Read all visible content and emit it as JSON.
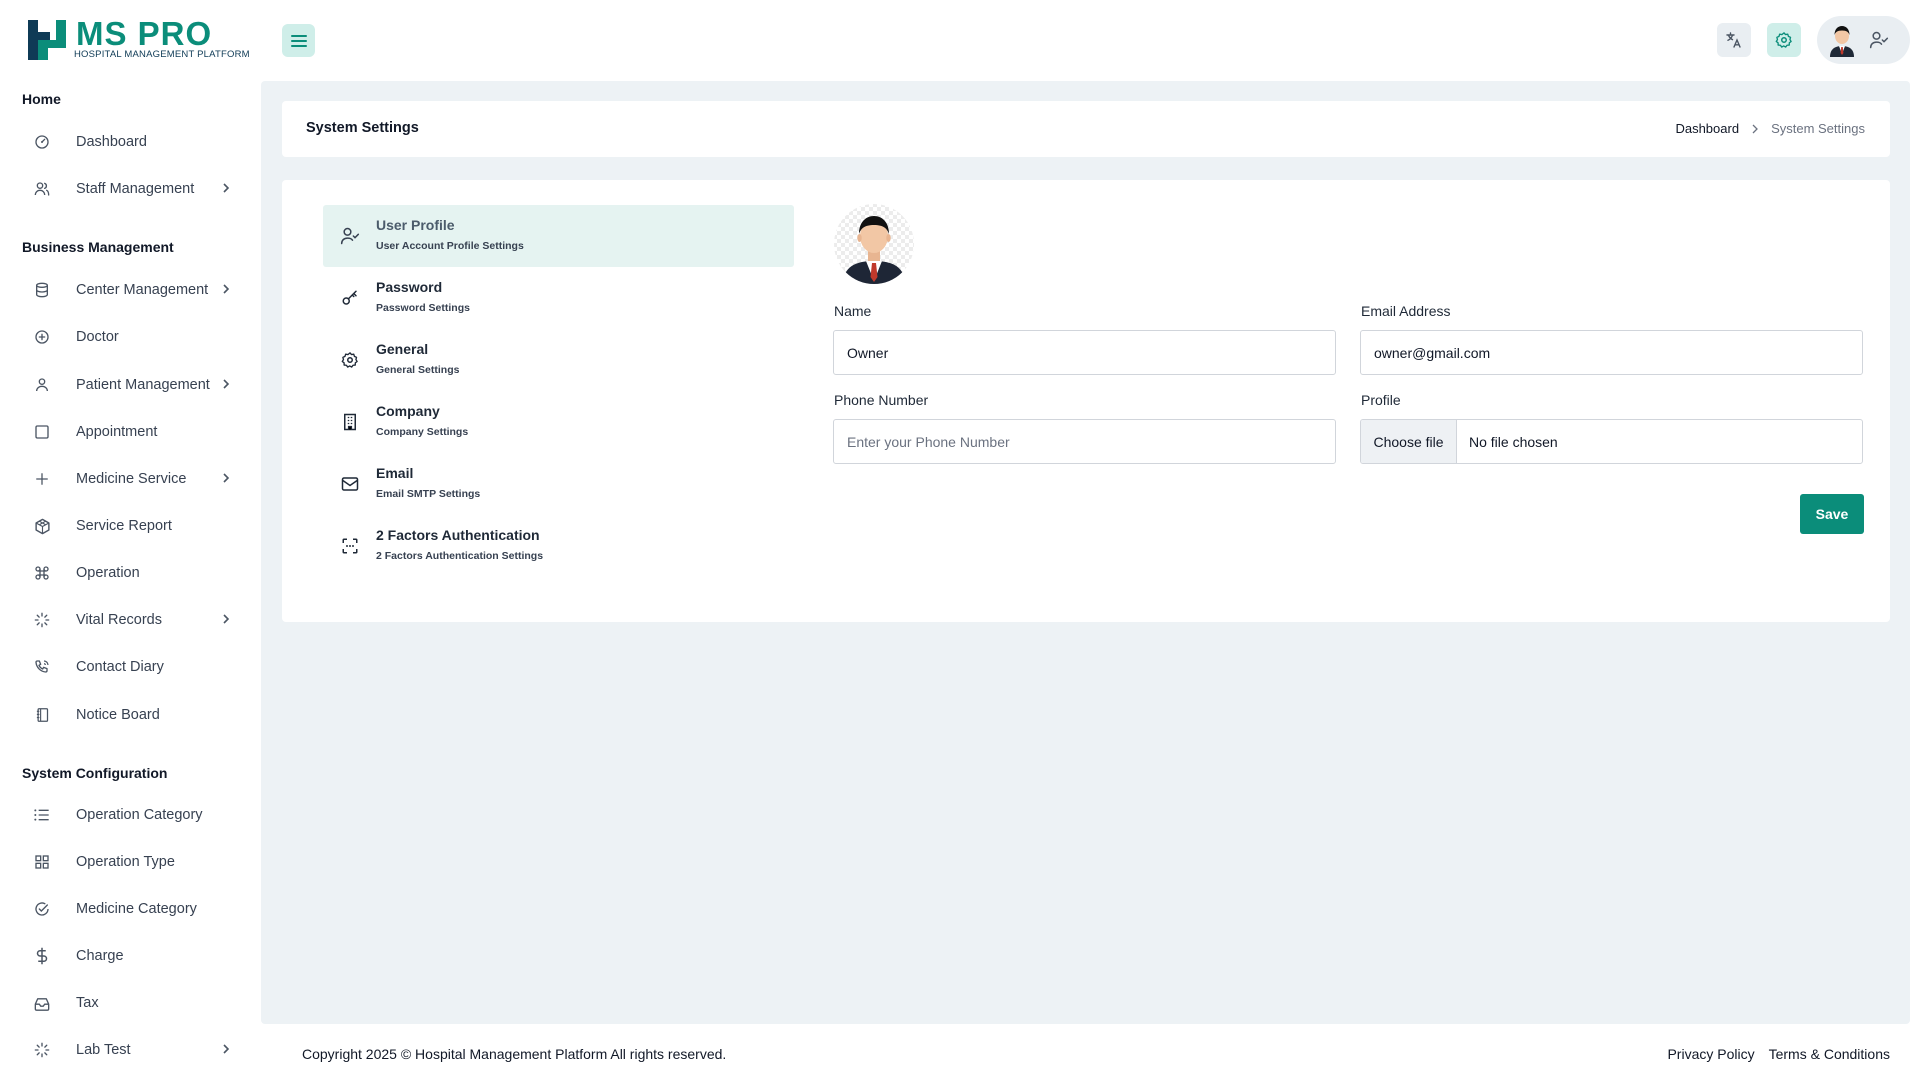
{
  "header": {
    "logo_brand": "MS PRO",
    "logo_tagline": "HOSPITAL MANAGEMENT PLATFORM",
    "menu_icon": "hamburger-icon",
    "translate_icon": "translate-icon",
    "settings_icon": "gear-icon",
    "user_icon": "user-check-icon"
  },
  "sidebar": {
    "sections": [
      {
        "title": "Home"
      },
      {
        "title": "Business Management"
      },
      {
        "title": "System Configuration"
      }
    ],
    "items": [
      {
        "label": "Dashboard",
        "icon": "dashboard-icon",
        "has_submenu": false
      },
      {
        "label": "Staff Management",
        "icon": "users-icon",
        "has_submenu": true
      },
      {
        "label": "Center Management",
        "icon": "database-icon",
        "has_submenu": true
      },
      {
        "label": "Doctor",
        "icon": "plus-circle-icon",
        "has_submenu": false
      },
      {
        "label": "Patient Management",
        "icon": "user-icon",
        "has_submenu": true
      },
      {
        "label": "Appointment",
        "icon": "square-icon",
        "has_submenu": false
      },
      {
        "label": "Medicine Service",
        "icon": "plus-icon",
        "has_submenu": true
      },
      {
        "label": "Service Report",
        "icon": "codesandbox-icon",
        "has_submenu": false
      },
      {
        "label": "Operation",
        "icon": "command-icon",
        "has_submenu": false
      },
      {
        "label": "Vital Records",
        "icon": "loader-icon",
        "has_submenu": true
      },
      {
        "label": "Contact Diary",
        "icon": "phone-icon",
        "has_submenu": false
      },
      {
        "label": "Notice Board",
        "icon": "notebook-icon",
        "has_submenu": false
      },
      {
        "label": "Operation Category",
        "icon": "list-icon",
        "has_submenu": false
      },
      {
        "label": "Operation Type",
        "icon": "grid-icon",
        "has_submenu": false
      },
      {
        "label": "Medicine Category",
        "icon": "check-circle-icon",
        "has_submenu": false
      },
      {
        "label": "Charge",
        "icon": "dollar-icon",
        "has_submenu": false
      },
      {
        "label": "Tax",
        "icon": "inbox-icon",
        "has_submenu": false
      },
      {
        "label": "Lab Test",
        "icon": "loader-icon",
        "has_submenu": true
      }
    ]
  },
  "page": {
    "title": "System Settings",
    "breadcrumb": {
      "home": "Dashboard",
      "current": "System Settings"
    }
  },
  "settings_menu": [
    {
      "title": "User Profile",
      "subtitle": "User Account Profile Settings",
      "icon": "user-check-icon",
      "active": true
    },
    {
      "title": "Password",
      "subtitle": "Password Settings",
      "icon": "key-icon",
      "active": false
    },
    {
      "title": "General",
      "subtitle": "General Settings",
      "icon": "gear-icon",
      "active": false
    },
    {
      "title": "Company",
      "subtitle": "Company Settings",
      "icon": "building-icon",
      "active": false
    },
    {
      "title": "Email",
      "subtitle": "Email SMTP Settings",
      "icon": "mail-icon",
      "active": false
    },
    {
      "title": "2 Factors Authentication",
      "subtitle": "2 Factors Authentication Settings",
      "icon": "scan-icon",
      "active": false
    }
  ],
  "form": {
    "name_label": "Name",
    "name_value": "Owner",
    "email_label": "Email Address",
    "email_value": "owner@gmail.com",
    "phone_label": "Phone Number",
    "phone_value": "",
    "phone_placeholder": "Enter your Phone Number",
    "profile_label": "Profile",
    "file_button": "Choose file",
    "file_status": "No file chosen",
    "save_label": "Save"
  },
  "footer": {
    "copyright": "Copyright 2025 © Hospital Management Platform All rights reserved.",
    "privacy": "Privacy Policy",
    "terms": "Terms & Conditions"
  },
  "colors": {
    "brand": "#0b8d7a",
    "brand_light": "#cfeee9",
    "main_bg": "#edf2f5",
    "active_item": "#e5f3f1"
  }
}
